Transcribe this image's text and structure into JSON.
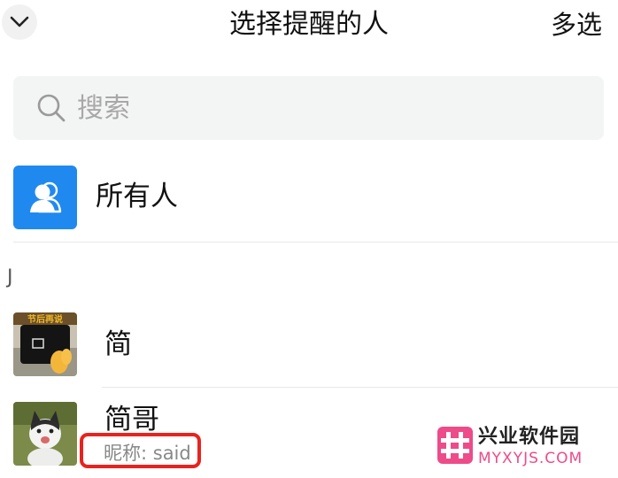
{
  "header": {
    "title": "选择提醒的人",
    "multi_select_label": "多选"
  },
  "search": {
    "placeholder": "搜索",
    "value": ""
  },
  "everyone": {
    "label": "所有人"
  },
  "sections": [
    {
      "letter": "J",
      "contacts": [
        {
          "name": "简",
          "avatar_caption": "节后再说"
        },
        {
          "name": "简哥",
          "nickname": "昵称: said"
        }
      ]
    }
  ],
  "watermark": {
    "name": "兴业软件园",
    "url": "MYXYJS.COM"
  },
  "colors": {
    "accent_blue": "#2089f0",
    "highlight_red": "#e8231f",
    "watermark_pink": "#ee4b8a"
  }
}
